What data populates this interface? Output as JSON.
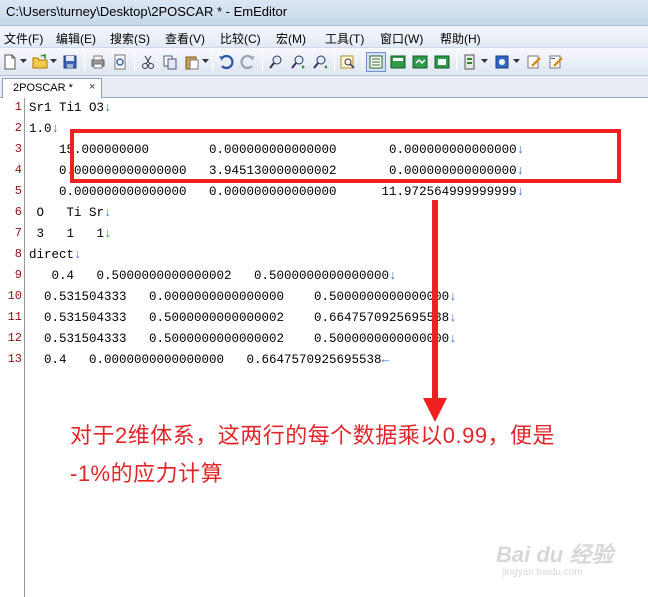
{
  "window": {
    "title": "C:\\Users\\turney\\Desktop\\2POSCAR * - EmEditor"
  },
  "menu": [
    {
      "label": "文件(F)"
    },
    {
      "label": "编辑(E)"
    },
    {
      "label": "搜索(S)"
    },
    {
      "label": "查看(V)"
    },
    {
      "label": "比较(C)"
    },
    {
      "label": "宏(M)"
    },
    {
      "label": "工具(T)"
    },
    {
      "label": "窗口(W)"
    },
    {
      "label": "帮助(H)"
    }
  ],
  "toolbar": {
    "icons": [
      "new-file-icon",
      "open-folder-icon",
      "save-icon",
      "print-icon",
      "print-preview-icon",
      "cut-icon",
      "copy-icon",
      "paste-icon",
      "undo-icon",
      "redo-icon",
      "find-icon",
      "find-next-icon",
      "find-prev-icon",
      "replace-icon",
      "word-wrap-icon",
      "view-icon-1",
      "view-icon-2",
      "view-icon-3",
      "config-icon",
      "plugin-icon",
      "edit-icon-1",
      "edit-icon-2"
    ]
  },
  "tab": {
    "label": "2POSCAR *",
    "close": "×"
  },
  "editor": {
    "line_numbers": [
      "1",
      "2",
      "3",
      "4",
      "5",
      "6",
      "7",
      "8",
      "9",
      "10",
      "11",
      "12",
      "13"
    ],
    "lines": [
      {
        "text": "Sr1 Ti1 O3",
        "eol": "↓"
      },
      {
        "text": "1.0",
        "eol": "↓"
      },
      {
        "text": "    15.000000000        0.000000000000000       0.000000000000000",
        "eol": "↓"
      },
      {
        "text": "    0.000000000000000   3.945130000000002       0.000000000000000",
        "eol": "↓"
      },
      {
        "text": "    0.000000000000000   0.000000000000000      11.972564999999999",
        "eol": "↓"
      },
      {
        "text": " O   Ti Sr",
        "eol": "↓"
      },
      {
        "text": " 3   1   1",
        "eol": "↓"
      },
      {
        "text": "direct",
        "eol": "↓"
      },
      {
        "text": "   0.4   0.5000000000000002   0.5000000000000000",
        "eol": "↓"
      },
      {
        "text": "  0.531504333   0.0000000000000000    0.5000000000000000",
        "eol": "↓"
      },
      {
        "text": "  0.531504333   0.5000000000000002    0.6647570925695538",
        "eol": "↓"
      },
      {
        "text": "  0.531504333   0.5000000000000002    0.5000000000000000",
        "eol": "↓"
      },
      {
        "text": "  0.4   0.0000000000000000   0.6647570925695538",
        "eol": "←"
      }
    ]
  },
  "annotation": {
    "line1": "对于2维体系，这两行的每个数据乘以0.99，便是",
    "line2": "-1%的应力计算",
    "color": "#e0262a"
  },
  "watermark": {
    "brand": "Bai du 经验",
    "url": "jingyan.baidu.com"
  }
}
